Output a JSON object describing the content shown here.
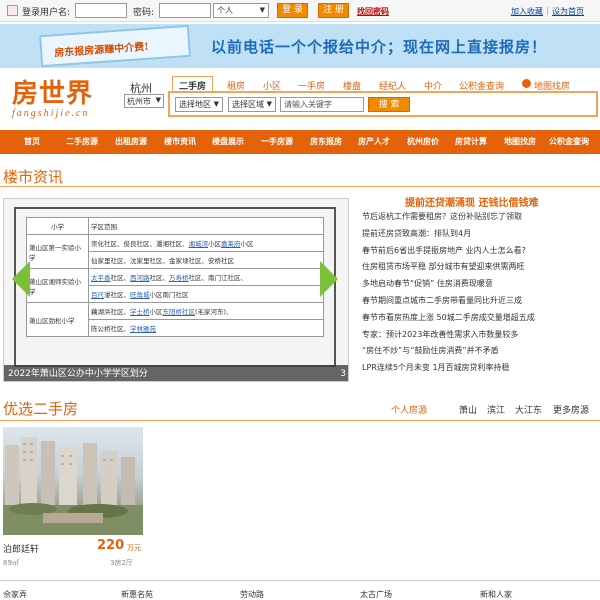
{
  "topbar": {
    "username_label": "登录用户名:",
    "password_label": "密码:",
    "role_select": "个人",
    "login_button": "登 录",
    "register_button": "注 册",
    "forgot_password": "找回密码",
    "add_favorite": "加入收藏",
    "divider": "|",
    "set_homepage": "设为首页"
  },
  "banner": {
    "card_text": "房东报房源赚中介费!",
    "slogan": "以前电话一个个报给中介；现在网上直接报房！"
  },
  "logo": {
    "cn": "房世界",
    "en": "fangshijie.cn"
  },
  "city": {
    "name": "杭州",
    "select": "杭州市"
  },
  "search": {
    "tabs": [
      "二手房",
      "租房",
      "小区",
      "一手房",
      "楼盘",
      "经纪人",
      "中介",
      "公积金查询"
    ],
    "map_link": "地图找房",
    "region_select": "选择地区",
    "area_select": "选择区域",
    "keyword_placeholder": "请输入关键字",
    "search_button": "搜 索"
  },
  "nav": [
    "首页",
    "二手房源",
    "出租房源",
    "楼市资讯",
    "楼盘展示",
    "一手房源",
    "房东报房",
    "房产人才",
    "杭州房价",
    "房贷计算",
    "地图找房",
    "公积金查询"
  ],
  "market_news": {
    "title": "楼市资讯",
    "slide": {
      "caption": "2022年萧山区公办中小学学区划分",
      "counter": "3",
      "table": {
        "header": [
          "小学",
          "学区范围"
        ],
        "rows": [
          {
            "school": "萧山区第一实验小学",
            "span": 2,
            "lines": [
              [
                "崇化社区、",
                "俊良社区、",
                "潘湘社区、",
                "湘城湾",
                "小区",
                "嘉莱府",
                "小区"
              ],
              [
                "仙家里社区、",
                "沈家里社区、",
                "金家埭社区、",
                "安桥社区"
              ]
            ]
          },
          {
            "school": "萧山区湘师实验小学",
            "span": 2,
            "lines": [
              [
                "太平香",
                "社区、",
                "西河路",
                "社区、",
                "万寿桥",
                "社区、",
                "南门江社区、"
              ],
              [
                "百尺",
                "溇社区、",
                "旺角城",
                "小区",
                "南门社区"
              ]
            ]
          },
          {
            "school": "萧山区劲松小学",
            "span": 2,
            "lines": [
              [
                "藕湖浜社区、",
                "学士桥",
                "小区",
                "东阳桥社区",
                "(毛家河东)、"
              ],
              [
                "陈公桥社区、",
                "学林雅苑"
              ]
            ]
          }
        ]
      }
    },
    "headline": "提前还贷潮涌现 还钱比借钱难",
    "items": [
      "节后返杭工作需要租房？这份补贴别忘了领取",
      "提前还房贷致高潮：排队到4月",
      "春节前后6省出手提振房地产 业内人士怎么看?",
      "住房租赁市场平稳 部分城市有望迎来供需两旺",
      "多地启动春节“促销” 住房消费现暖意",
      "春节期间重点城市二手房带看量同比升近三成",
      "春节市看房热度上涨 50城二手房成交量增超五成",
      "专家：预计2023年改善性需求入市数量较多",
      "“房住不炒”与“鼓励住房消费”并不矛盾",
      "LPR连续5个月未变 1月百城房贷利率持稳"
    ]
  },
  "second_hand": {
    "title": "优选二手房",
    "tabs": [
      "个人房源",
      "萧山",
      "滨江",
      "大江东",
      "更多房源"
    ],
    "listing": {
      "name": "泊郎廷轩",
      "price": "220",
      "unit": "万元",
      "area": "89㎡",
      "layout": "3房2厅"
    },
    "footer": [
      "佘家弄",
      "新惠名苑",
      "劳动路",
      "太古广场",
      "新和人家"
    ]
  },
  "colors": {
    "brand": "#e4620a",
    "nav_bg": "#e4620a",
    "banner_bg": "#bfe0f5",
    "arrow": "#7cc03a"
  }
}
